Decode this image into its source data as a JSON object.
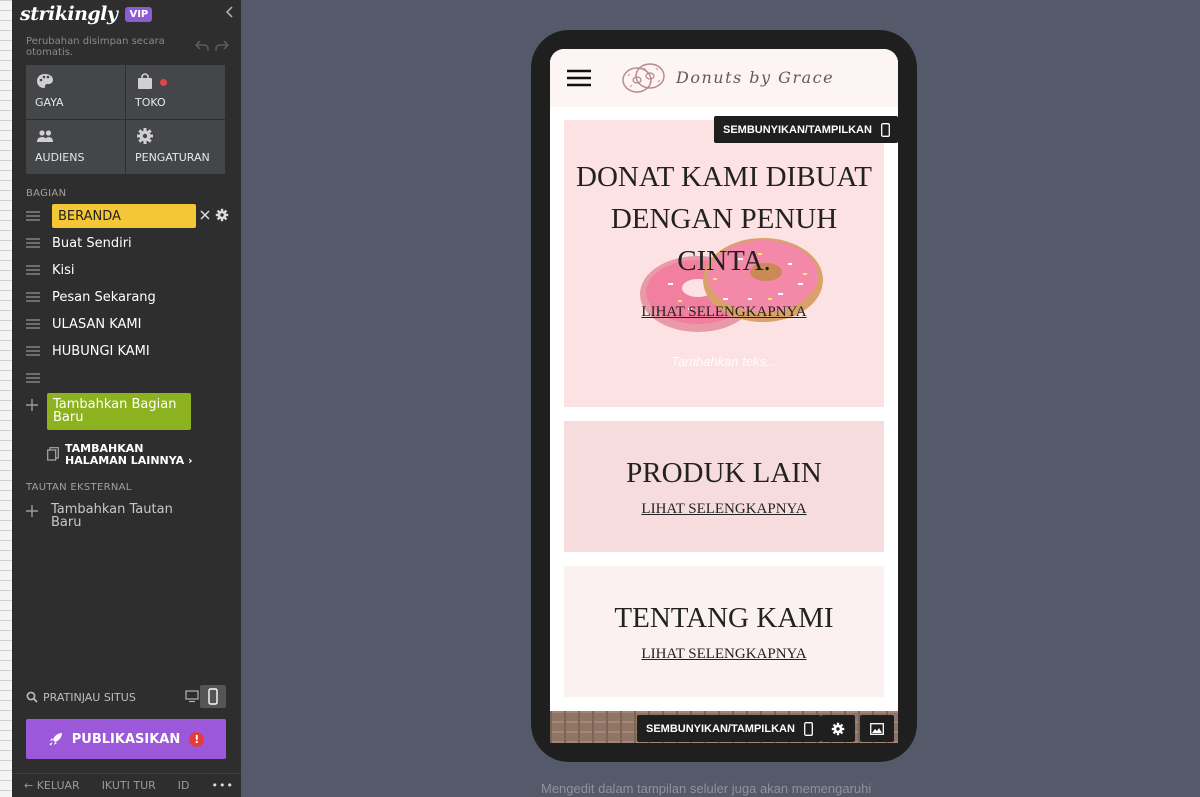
{
  "app": {
    "name": "strikingly",
    "badge": "VIP"
  },
  "autosave": "Perubahan disimpan secara otomatis.",
  "tiles": [
    {
      "label": "GAYA",
      "icon": "palette-icon"
    },
    {
      "label": "TOKO",
      "icon": "shopping-bag-icon"
    },
    {
      "label": "AUDIENS",
      "icon": "people-icon"
    },
    {
      "label": "PENGATURAN",
      "icon": "gear-icon"
    }
  ],
  "sections": {
    "heading": "BAGIAN",
    "items": [
      "BERANDA",
      "Buat Sendiri",
      "Kisi",
      "Pesan Sekarang",
      "ULASAN KAMI",
      "HUBUNGI KAMI"
    ],
    "add_label": "Tambahkan Bagian Baru",
    "more_pages": "TAMBAHKAN HALAMAN LAINNYA ›"
  },
  "external": {
    "heading": "TAUTAN EKSTERNAL",
    "add_label": "Tambahkan Tautan Baru"
  },
  "preview": {
    "label": "PRATINJAU SITUS"
  },
  "publish": {
    "label": "PUBLIKASIKAN",
    "warning": "!"
  },
  "footer": {
    "exit": "← KELUAR",
    "tour": "IKUTI TUR",
    "lang": "ID",
    "more": "•••"
  },
  "site": {
    "brand": "Donuts by Grace",
    "hero": {
      "title": "DONAT KAMI DIBUAT DENGAN PENUH CINTA.",
      "link": "LIHAT SELENGKAPNYA",
      "placeholder": "Tambahkan teks..."
    },
    "blocks": [
      {
        "title": "PRODUK LAIN",
        "link": "LIHAT SELENGKAPNYA"
      },
      {
        "title": "TENTANG KAMI",
        "link": "LIHAT SELENGKAPNYA"
      }
    ]
  },
  "toggle_label": "SEMBUNYIKAN/TAMPILKAN",
  "caption": "Mengedit dalam tampilan seluler juga akan memengaruhi",
  "colors": {
    "accent_yellow": "#f4c736",
    "accent_green": "#8cb220",
    "accent_purple": "#9b59d9",
    "hero_bg": "#fde2e4"
  }
}
